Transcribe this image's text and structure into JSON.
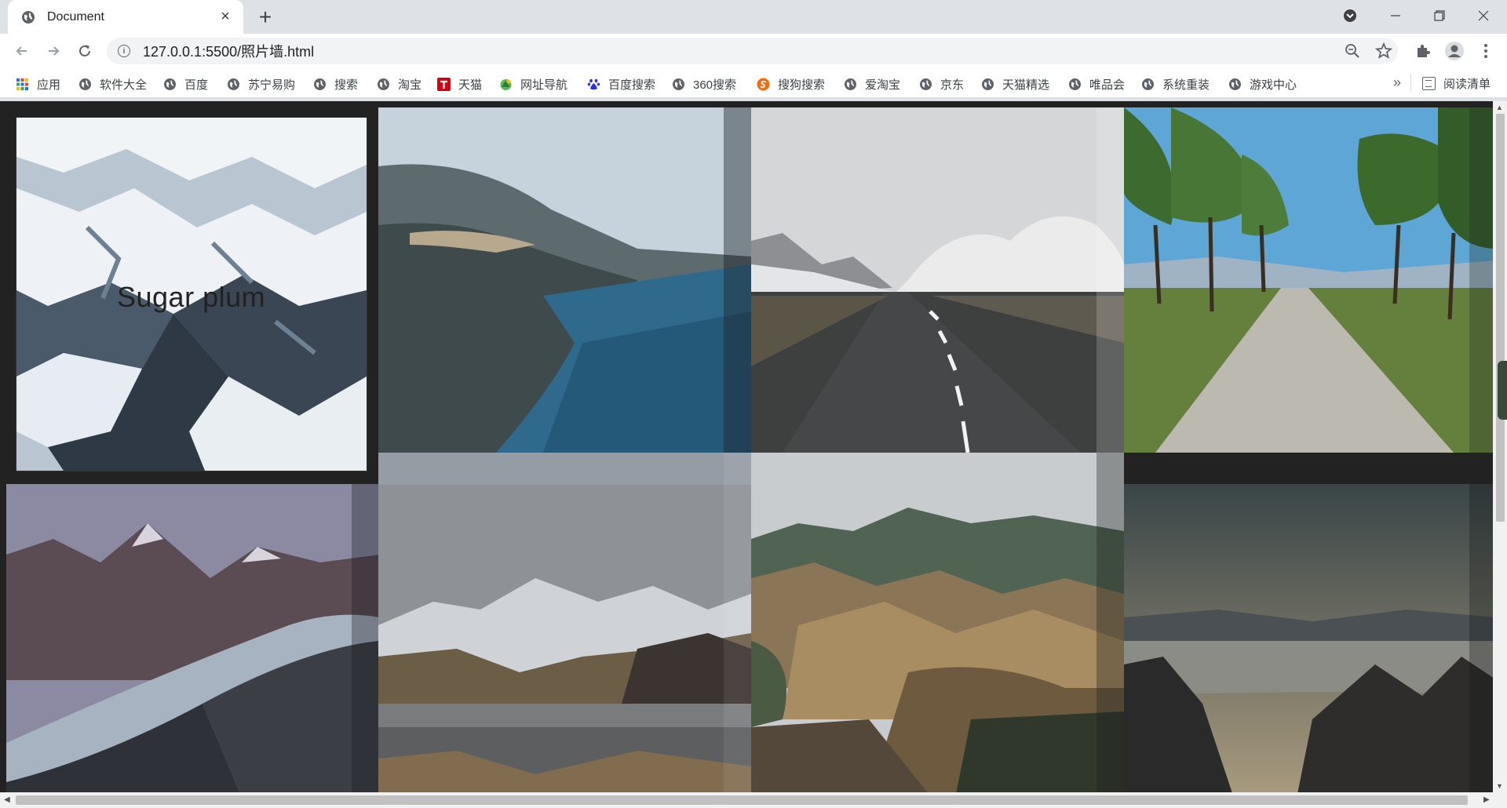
{
  "tab": {
    "title": "Document",
    "close_glyph": "×",
    "icon": "globe-icon"
  },
  "newtab_glyph": "+",
  "window": {
    "profile_icon": "profile-menu-icon",
    "minimize": "—",
    "restore": "❐",
    "close": "✕"
  },
  "toolbar": {
    "back_icon": "back-arrow-icon",
    "forward_icon": "forward-arrow-icon",
    "reload_icon": "reload-icon",
    "url": "127.0.0.1:5500/照片墙.html",
    "zoom_icon": "zoom-out-icon",
    "bookmark_icon": "star-icon",
    "extensions_icon": "puzzle-icon",
    "profile_icon": "avatar-icon",
    "menu_icon": "kebab-menu-icon"
  },
  "bookmarks": {
    "items": [
      {
        "label": "应用",
        "icon": "apps-grid-icon"
      },
      {
        "label": "软件大全",
        "icon": "globe-icon"
      },
      {
        "label": "百度",
        "icon": "globe-icon"
      },
      {
        "label": "苏宁易购",
        "icon": "globe-icon"
      },
      {
        "label": "搜索",
        "icon": "globe-icon"
      },
      {
        "label": "淘宝",
        "icon": "globe-icon"
      },
      {
        "label": "天猫",
        "icon": "tmall-icon"
      },
      {
        "label": "网址导航",
        "icon": "navigation-icon"
      },
      {
        "label": "百度搜索",
        "icon": "baidu-paw-icon"
      },
      {
        "label": "360搜索",
        "icon": "globe-icon"
      },
      {
        "label": "搜狗搜索",
        "icon": "sogou-icon"
      },
      {
        "label": "爱淘宝",
        "icon": "globe-icon"
      },
      {
        "label": "京东",
        "icon": "globe-icon"
      },
      {
        "label": "天猫精选",
        "icon": "globe-icon"
      },
      {
        "label": "唯品会",
        "icon": "globe-icon"
      },
      {
        "label": "系统重装",
        "icon": "globe-icon"
      },
      {
        "label": "游戏中心",
        "icon": "globe-icon"
      }
    ],
    "more_glyph": "»",
    "reading_list": "阅读清单"
  },
  "page": {
    "overlay_text": "Sugar plum",
    "photos": [
      {
        "name": "glacier-ice",
        "colors": [
          "#e8eef3",
          "#5d6e80",
          "#2c3440"
        ]
      },
      {
        "name": "coastal-cliff",
        "colors": [
          "#c5d2dc",
          "#4a6a80",
          "#2d5c7a"
        ]
      },
      {
        "name": "steaming-road",
        "colors": [
          "#d5d7d9",
          "#777",
          "#3b3b3b"
        ]
      },
      {
        "name": "tree-lined-road",
        "colors": [
          "#5ea6d6",
          "#6b8a3e",
          "#b9b6ad"
        ]
      },
      {
        "name": "glacier-river",
        "colors": [
          "#8e8aa0",
          "#5a4e52",
          "#2a2d33"
        ]
      },
      {
        "name": "snowy-lake",
        "colors": [
          "#8f9296",
          "#6b6a66",
          "#585a5c"
        ]
      },
      {
        "name": "colorful-hills",
        "colors": [
          "#c9cdcf",
          "#7a6a4e",
          "#3d4430"
        ]
      },
      {
        "name": "sea-of-clouds",
        "colors": [
          "#3c4648",
          "#8c8d86",
          "#262525"
        ]
      }
    ]
  }
}
